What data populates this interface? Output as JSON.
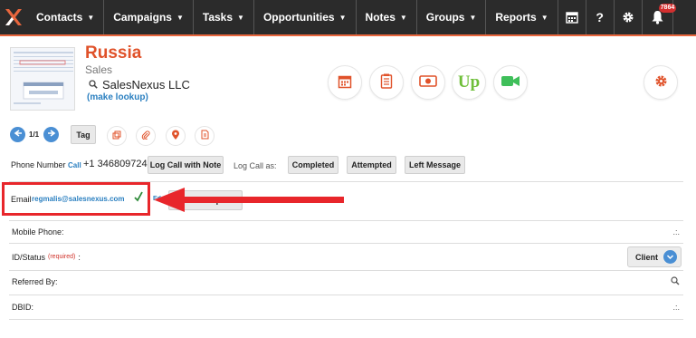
{
  "nav": {
    "items": [
      {
        "label": "Contacts"
      },
      {
        "label": "Campaigns"
      },
      {
        "label": "Tasks"
      },
      {
        "label": "Opportunities"
      },
      {
        "label": "Notes"
      },
      {
        "label": "Groups"
      },
      {
        "label": "Reports"
      }
    ],
    "help_label": "?",
    "badge_count": "7864"
  },
  "header": {
    "title": "Russia",
    "subtitle": "Sales",
    "company": "SalesNexus LLC",
    "lookup_link": "(make lookup)"
  },
  "toolbar": {
    "page_count": "1/1",
    "tag_label": "Tag"
  },
  "phone": {
    "label": "Phone Number",
    "call_link": "Call",
    "number": "+1 346809724",
    "log_button": "Log Call with Note",
    "log_as_label": "Log Call as:",
    "completed": "Completed",
    "attempted": "Attempted",
    "left_message": "Left Message"
  },
  "email": {
    "label": "Email",
    "address": "regmalis@salesnexus.com",
    "edit_link": "Edit",
    "template_button": "Email Template"
  },
  "fields": {
    "mobile_label": "Mobile Phone:",
    "status_label": "ID/Status",
    "required": "(required)",
    "status_colon": ":",
    "status_value": "Client",
    "referred_label": "Referred By:",
    "dbid_label": "DBID:"
  },
  "colors": {
    "brand_orange": "#e0522a",
    "nav_bg": "#2b2b2b",
    "link_blue": "#2a7fc0",
    "annotation_red": "#e8262b",
    "upwork_green": "#6fbf3a"
  }
}
